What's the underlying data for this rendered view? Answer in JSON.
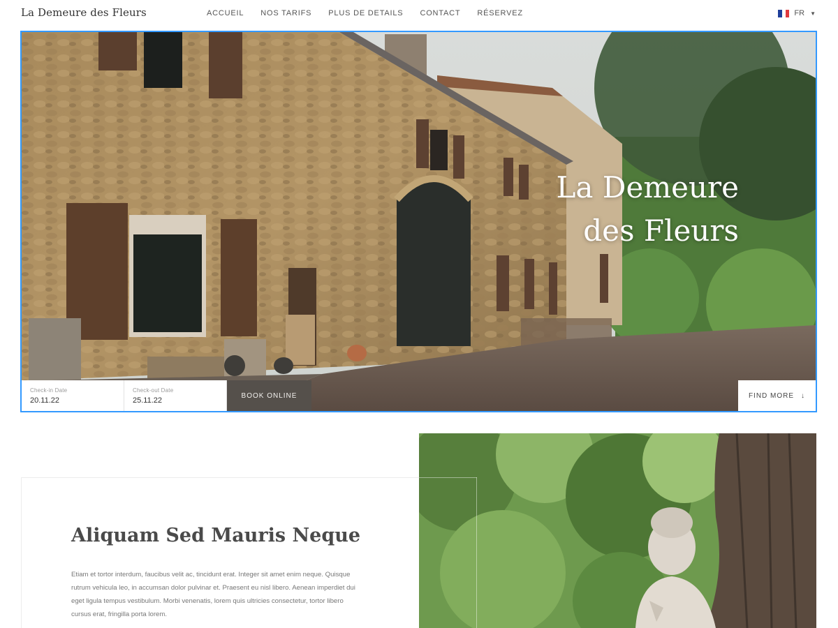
{
  "header": {
    "brand": "La Demeure des Fleurs",
    "nav": [
      "ACCUEIL",
      "NOS TARIFS",
      "PLUS DE DETAILS",
      "CONTACT",
      "RÉSERVEZ"
    ],
    "language": {
      "code": "FR",
      "icon": "france-flag-icon",
      "colors": [
        "#1f3f9a",
        "#ffffff",
        "#e03a3e"
      ]
    }
  },
  "hero": {
    "title_line1": "La Demeure",
    "title_line2": "des Fleurs",
    "booking": {
      "checkin_label": "Check-in Date",
      "checkin_value": "20.11.22",
      "checkout_label": "Check-out Date",
      "checkout_value": "25.11.22",
      "book_button": "BOOK ONLINE"
    },
    "find_more": "FIND MORE",
    "find_more_icon": "arrow-down-icon"
  },
  "section": {
    "title": "Aliquam Sed Mauris Neque",
    "body": "Etiam et tortor interdum, faucibus velit ac, tincidunt erat. Integer sit amet enim neque. Quisque rutrum vehicula leo, in accumsan dolor pulvinar et. Praesent eu nisl libero. Aenean imperdiet dui eget ligula tempus vestibulum. Morbi venenatis, lorem quis ultricies consectetur, tortor libero cursus erat, fringilla porta lorem."
  },
  "colors": {
    "accent_border": "#3399ff",
    "book_button_bg": "#55504b"
  }
}
